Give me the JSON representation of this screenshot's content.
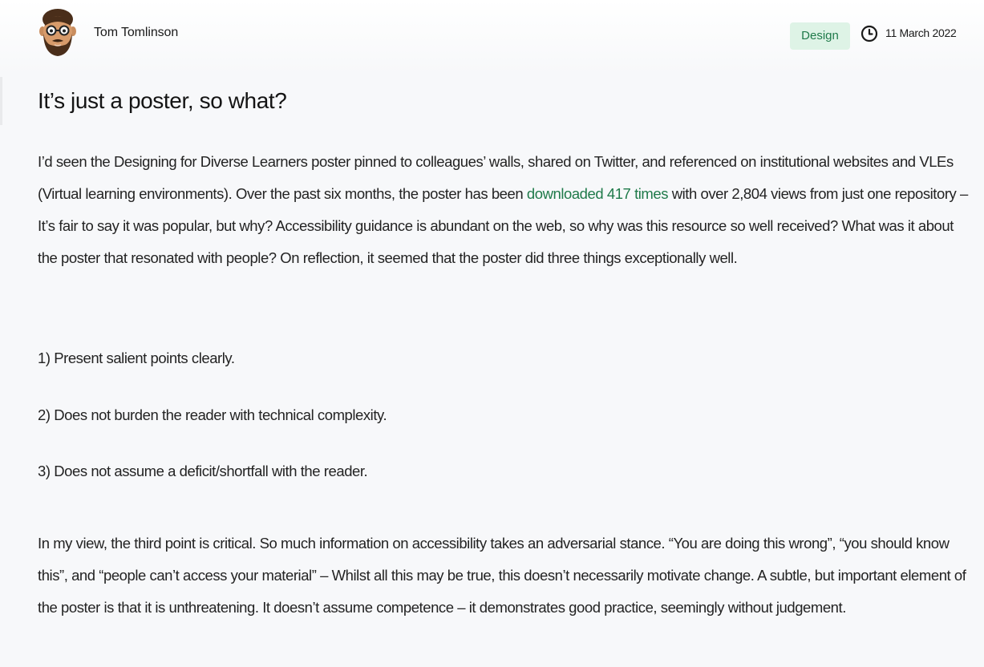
{
  "header": {
    "author_name": "Tom Tomlinson",
    "category_tag": "Design",
    "date": "11 March 2022",
    "icons": {
      "avatar": "bearded-man-avatar",
      "date": "clock-icon"
    },
    "colors": {
      "tag_background": "#def3e6",
      "tag_text": "#1f7a4a",
      "link": "#1f7a4a"
    }
  },
  "article": {
    "title": "It’s just a poster, so what?",
    "intro_before_link": "I’d seen the Designing for Diverse Learners poster pinned to colleagues’ walls, shared on Twitter, and referenced on institutional websites and VLEs (Virtual learning environments). Over the past six months, the poster has been ",
    "intro_link": "downloaded 417 times",
    "intro_after_link": " with over 2,804 views from just one repository – It’s fair to say it was popular, but why? Accessibility guidance is abundant on the web, so why was this resource so well received? What was it about the poster that resonated with people? On reflection, it seemed that the poster did three things exceptionally well.",
    "points": [
      "1) Present salient points clearly.",
      "2) Does not burden the reader with technical complexity.",
      "3) Does not assume a deficit/shortfall with the reader."
    ],
    "closing": "In my view, the third point is critical. So much information on accessibility takes an adversarial stance. “You are doing this wrong”, “you should know this”, and “people can’t access your material” – Whilst all this may be true, this doesn’t necessarily motivate change. A subtle, but important element of the poster is that it is unthreatening. It doesn’t assume competence – it demonstrates good practice, seemingly without judgement."
  }
}
